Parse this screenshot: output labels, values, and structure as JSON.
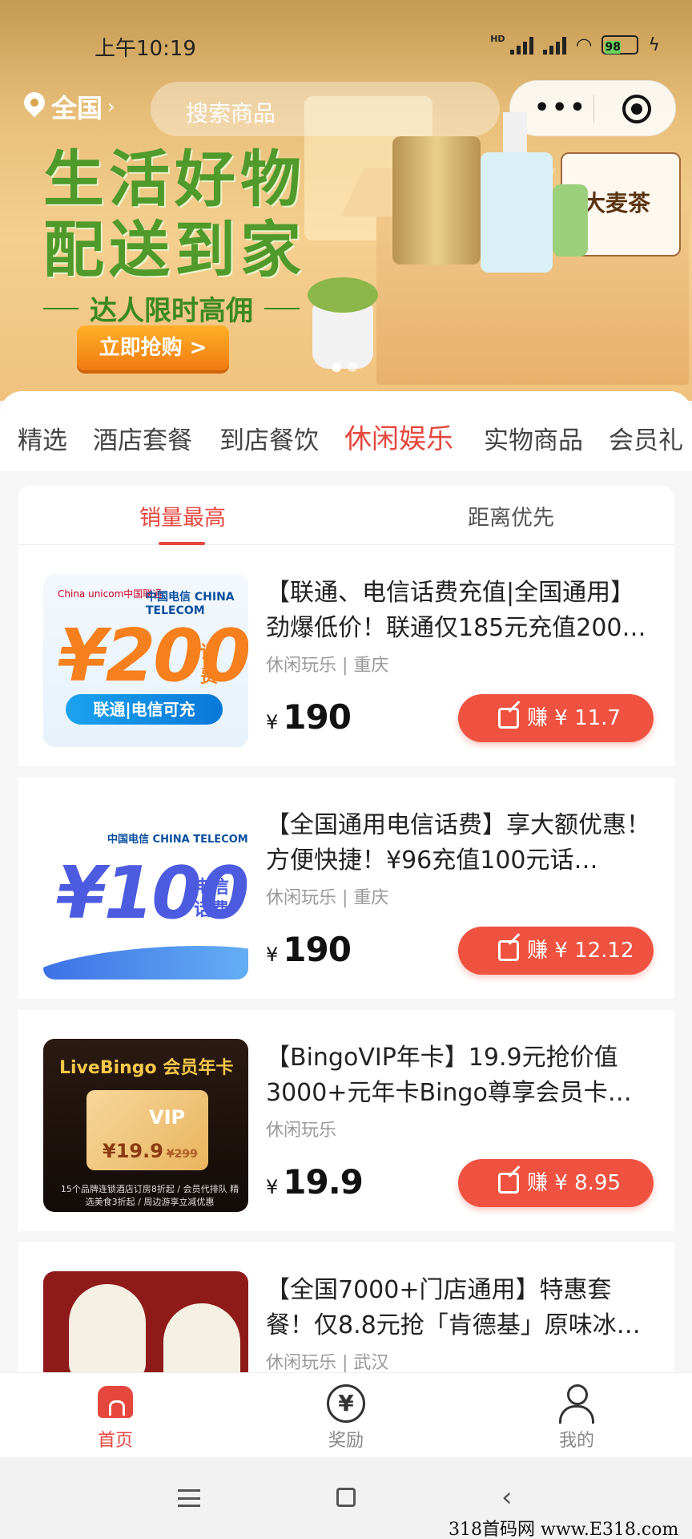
{
  "status_bar": {
    "time": "上午10:19",
    "battery": "98",
    "hd": "HD"
  },
  "header": {
    "location": "全国",
    "search_placeholder": "搜索商品",
    "capsule_more": "•••"
  },
  "banner": {
    "line1": "生活好物",
    "line2": "配送到家",
    "line3": "达人限时高佣",
    "button": "立即抢购 >",
    "box_label": "大麦茶"
  },
  "categories": [
    "精选",
    "酒店套餐",
    "到店餐饮",
    "休闲娱乐",
    "实物商品",
    "会员礼"
  ],
  "active_category": "休闲娱乐",
  "sort_tabs": [
    "销量最高",
    "距离优先"
  ],
  "products": [
    {
      "title": "【联通、电信话费充值|全国通用】劲爆低价！联通仅185元充值200…",
      "meta": "休闲玩乐 | 重庆",
      "currency": "¥",
      "price": "190",
      "earn": "赚 ¥ 11.7",
      "thumb": {
        "amount": "¥200",
        "unit": "话费",
        "pill": "联通|电信可充",
        "brand_a": "China unicom中国联通",
        "brand_b": "中国电信 CHINA TELECOM"
      }
    },
    {
      "title": "【全国通用电信话费】享大额优惠！方便快捷！¥96充值100元话…",
      "meta": "休闲玩乐 | 重庆",
      "currency": "¥",
      "price": "190",
      "earn": "赚 ¥ 12.12",
      "thumb": {
        "amount": "¥100",
        "unit": "电信话费",
        "brand": "中国电信 CHINA TELECOM"
      }
    },
    {
      "title": "【BingoVIP年卡】19.9元抢价值3000+元年卡Bingo尊享会员卡…",
      "meta": "休闲玩乐",
      "currency": "¥",
      "price": "19.9",
      "earn": "赚 ¥ 8.95",
      "thumb": {
        "heading": "LiveBingo 会员年卡",
        "vip": "VIP",
        "price": "¥19.9",
        "old": "¥299",
        "fine": "15个品牌连锁酒店订房8折起 / 会员代排队 精选美食3折起 / 周边游享立减优惠"
      }
    },
    {
      "title": "【全国7000+门店通用】特惠套餐！仅8.8元抢「肯德基」原味冰…",
      "meta": "休闲玩乐 | 武汉"
    }
  ],
  "tabbar": [
    {
      "label": "首页",
      "icon": "home-icon"
    },
    {
      "label": "奖励",
      "icon": "yen-icon"
    },
    {
      "label": "我的",
      "icon": "user-icon"
    }
  ],
  "watermark": "318首码网 www.E318.com",
  "colors": {
    "accent": "#e5473d",
    "earn_button": "#ef5240",
    "slogan_green": "#4f9a2a"
  }
}
